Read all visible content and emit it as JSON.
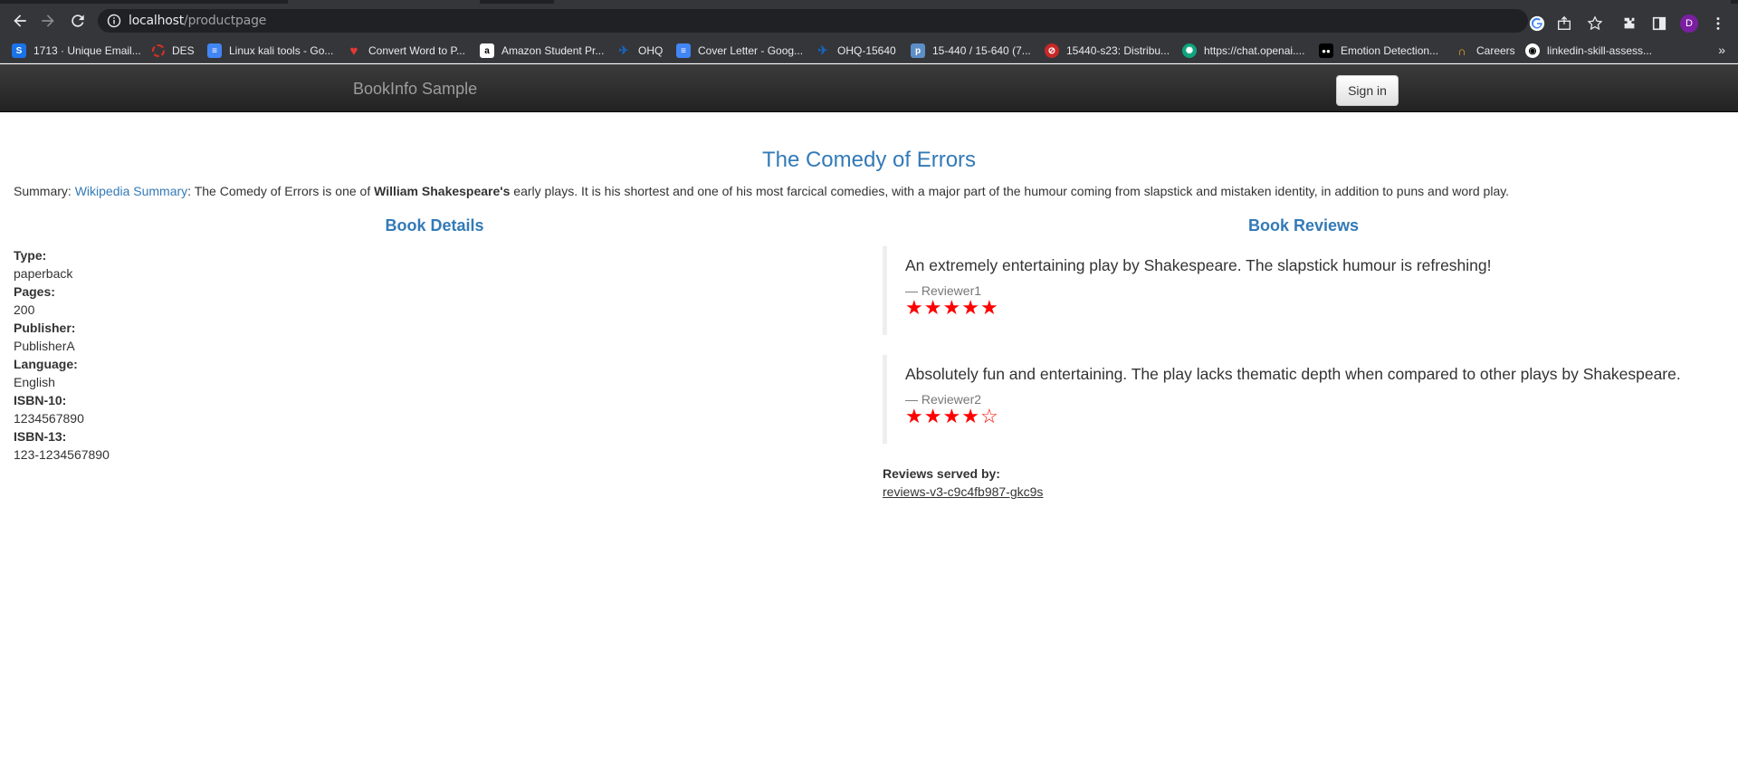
{
  "browser": {
    "url_host": "localhost",
    "url_path": "/productpage",
    "avatar_initial": "D",
    "bookmarks": [
      {
        "label": "1713 · Unique Email...",
        "icon": "leetcode-like-icon",
        "color": "#1a73e8"
      },
      {
        "label": "DES",
        "icon": "dashed-circle-icon",
        "color": "#d93025"
      },
      {
        "label": "Linux kali tools - Go...",
        "icon": "google-docs-icon",
        "color": "#4285f4"
      },
      {
        "label": "Convert Word to P...",
        "icon": "heart-icon",
        "color": "#e53935"
      },
      {
        "label": "Amazon Student Pr...",
        "icon": "amazon-icon",
        "color": "#ffffff"
      },
      {
        "label": "OHQ",
        "icon": "ohq-icon",
        "color": "#1565c0"
      },
      {
        "label": "Cover Letter - Goog...",
        "icon": "google-docs-icon",
        "color": "#4285f4"
      },
      {
        "label": "OHQ-15640",
        "icon": "ohq-icon",
        "color": "#1565c0"
      },
      {
        "label": "15-440 / 15-640 (7...",
        "icon": "piazza-icon",
        "color": "#5c8ec7"
      },
      {
        "label": "15440-s23: Distribu...",
        "icon": "blocked-icon",
        "color": "#c62828"
      },
      {
        "label": "https://chat.openai....",
        "icon": "openai-icon",
        "color": "#10a37f"
      },
      {
        "label": "Emotion Detection...",
        "icon": "medium-icon",
        "color": "#000000"
      },
      {
        "label": "Careers",
        "icon": "careers-icon",
        "color": "#f9a825"
      },
      {
        "label": "linkedin-skill-assess...",
        "icon": "github-icon",
        "color": "#ffffff"
      }
    ],
    "more_label": "»"
  },
  "navbar": {
    "brand": "BookInfo Sample",
    "signin_label": "Sign in"
  },
  "product": {
    "title": "The Comedy of Errors",
    "summary_prefix": "Summary: ",
    "summary_link": "Wikipedia Summary",
    "summary_text1": ": The Comedy of Errors is one of ",
    "summary_bold": "William Shakespeare's",
    "summary_text2": " early plays. It is his shortest and one of his most farcical comedies, with a major part of the humour coming from slapstick and mistaken identity, in addition to puns and word play."
  },
  "details": {
    "title": "Book Details",
    "fields": [
      {
        "label": "Type:",
        "value": "paperback"
      },
      {
        "label": "Pages:",
        "value": "200"
      },
      {
        "label": "Publisher:",
        "value": "PublisherA"
      },
      {
        "label": "Language:",
        "value": "English"
      },
      {
        "label": "ISBN-10:",
        "value": "1234567890"
      },
      {
        "label": "ISBN-13:",
        "value": "123-1234567890"
      }
    ]
  },
  "reviews": {
    "title": "Book Reviews",
    "items": [
      {
        "text": "An extremely entertaining play by Shakespeare. The slapstick humour is refreshing!",
        "reviewer": "— Reviewer1",
        "rating": 5,
        "max": 5
      },
      {
        "text": "Absolutely fun and entertaining. The play lacks thematic depth when compared to other plays by Shakespeare.",
        "reviewer": "— Reviewer2",
        "rating": 4,
        "max": 5
      }
    ],
    "star_color": "#ff0000",
    "served_label": "Reviews served by:",
    "served_pod": "reviews-v3-c9c4fb987-gkc9s"
  }
}
